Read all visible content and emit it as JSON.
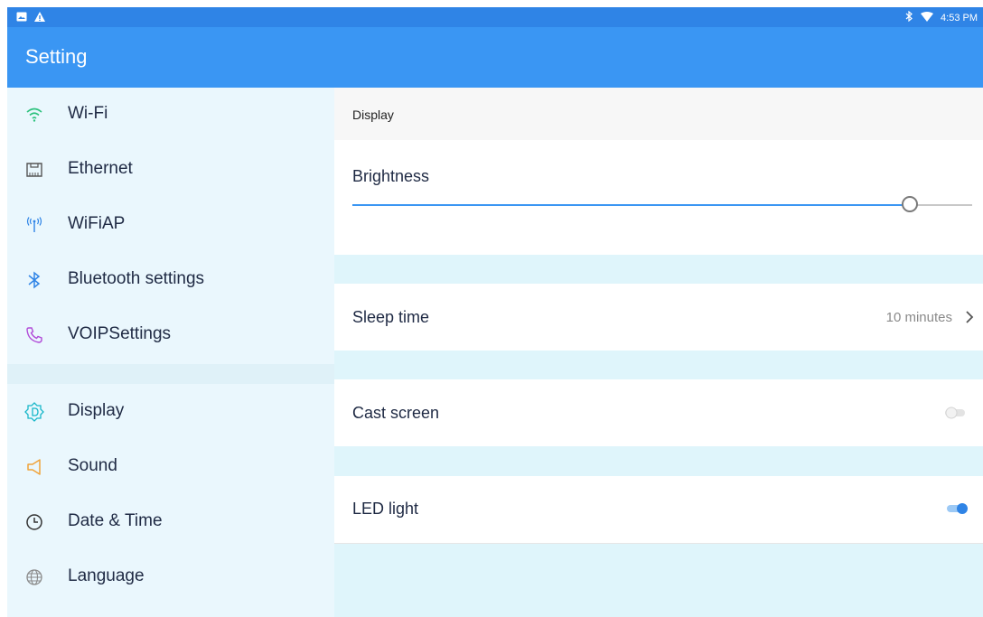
{
  "status": {
    "time": "4:53 PM",
    "left_icons": [
      "image-icon",
      "warning-icon"
    ],
    "right_icons": [
      "bluetooth-icon",
      "wifi-icon"
    ]
  },
  "app": {
    "title": "Setting"
  },
  "sidebar": {
    "items": [
      {
        "label": "Wi-Fi",
        "icon": "wifi-icon",
        "color": "#2ec27e"
      },
      {
        "label": "Ethernet",
        "icon": "ethernet-icon",
        "color": "#555555"
      },
      {
        "label": "WiFiAP",
        "icon": "hotspot-icon",
        "color": "#2f84e6"
      },
      {
        "label": "Bluetooth settings",
        "icon": "bluetooth-icon",
        "color": "#2f84e6"
      },
      {
        "label": "VOIPSettings",
        "icon": "phone-icon",
        "color": "#b14ad8"
      },
      {
        "label": "Display",
        "icon": "display-icon",
        "color": "#18b7c9"
      },
      {
        "label": "Sound",
        "icon": "sound-icon",
        "color": "#f0a33a"
      },
      {
        "label": "Date & Time",
        "icon": "clock-icon",
        "color": "#333333"
      },
      {
        "label": "Language",
        "icon": "globe-icon",
        "color": "#8a8a8a"
      }
    ]
  },
  "main": {
    "section_title": "Display",
    "brightness": {
      "label": "Brightness",
      "level": 0.9
    },
    "sleep_time": {
      "label": "Sleep time",
      "value": "10 minutes"
    },
    "cast_screen": {
      "label": "Cast screen",
      "enabled": false
    },
    "led_light": {
      "label": "LED light",
      "enabled": true
    }
  },
  "colors": {
    "accent": "#3a96f3",
    "statusbar": "#2f84e6",
    "sidebar_bg": "#eaf7fd",
    "main_bg": "#dff5fb"
  }
}
